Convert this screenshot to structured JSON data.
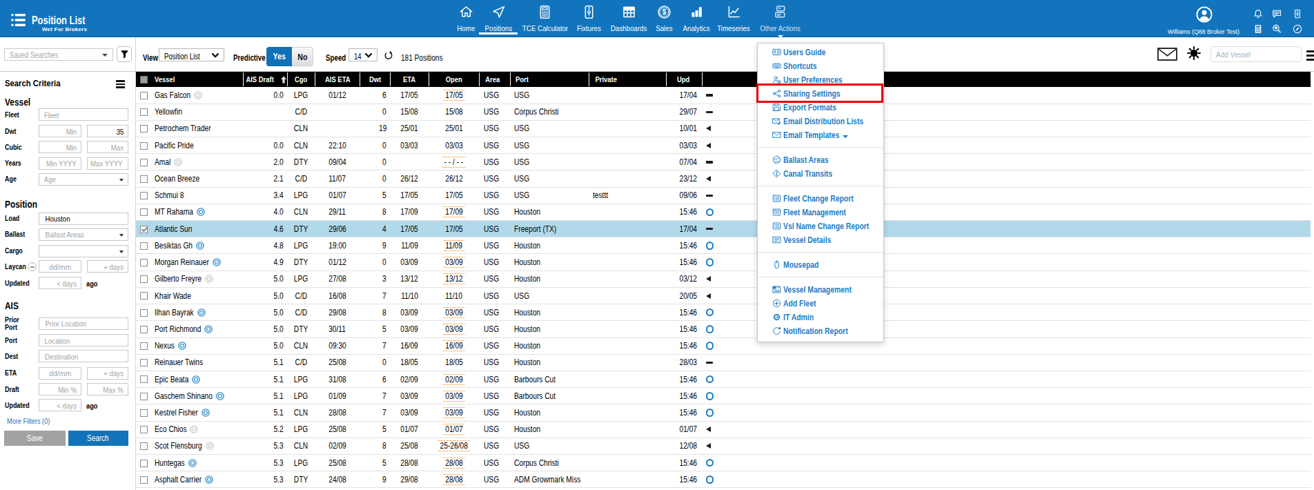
{
  "topbar": {
    "logo": {
      "title": "Position List",
      "subtitle": "Wet For Brokers"
    },
    "nav": [
      {
        "icon": "home-icon",
        "label": "Home"
      },
      {
        "icon": "positions-icon",
        "label": "Positions",
        "active": true
      },
      {
        "icon": "tce-calculator-icon",
        "label": "TCE Calculator"
      },
      {
        "icon": "fixtures-icon",
        "label": "Fixtures"
      },
      {
        "icon": "dashboards-icon",
        "label": "Dashboards"
      },
      {
        "icon": "sales-icon",
        "label": "Sales"
      },
      {
        "icon": "analytics-icon",
        "label": "Analytics"
      },
      {
        "icon": "timeseries-icon",
        "label": "Timeseries"
      },
      {
        "icon": "other-actions-icon",
        "label": "Other Actions",
        "open": true
      }
    ],
    "user": {
      "name": "Williams (Q88 Broker Test)"
    },
    "quick_icons": [
      "bell-icon",
      "chat-icon",
      "zip-icon",
      "calculator-icon",
      "vessel-search-icon",
      "compass-icon"
    ]
  },
  "toolbar": {
    "saved_searches_placeholder": "Saved Searches",
    "view_label": "View",
    "view_value": "Position List",
    "predictive_label": "Predictive",
    "predictive_options": [
      "Yes",
      "No"
    ],
    "predictive_selected": "Yes",
    "speed_label": "Speed",
    "speed_value": "14",
    "position_count": "181 Positions",
    "add_vessel_placeholder": "Add Vessel"
  },
  "sidebar": {
    "title": "Search Criteria",
    "sections": [
      {
        "title": "Vessel",
        "rows": [
          {
            "label": "Fleet",
            "widgets": [
              {
                "type": "input",
                "placeholder": "Fleet",
                "span": "full",
                "align": "l"
              }
            ]
          },
          {
            "label": "Dwt",
            "widgets": [
              {
                "type": "input",
                "placeholder": "Min",
                "span": "p1",
                "align": "r"
              },
              {
                "type": "input",
                "value": "35",
                "span": "p2",
                "align": "r"
              }
            ]
          },
          {
            "label": "Cubic",
            "widgets": [
              {
                "type": "input",
                "placeholder": "Min",
                "span": "p1",
                "align": "r"
              },
              {
                "type": "input",
                "placeholder": "Max",
                "span": "p2",
                "align": "r"
              }
            ]
          },
          {
            "label": "Years",
            "widgets": [
              {
                "type": "input",
                "placeholder": "Min YYYY",
                "span": "p1",
                "align": "r"
              },
              {
                "type": "input",
                "placeholder": "Max YYYY",
                "span": "p2",
                "align": "r"
              }
            ]
          },
          {
            "label": "Age",
            "widgets": [
              {
                "type": "select",
                "placeholder": "Age",
                "span": "full",
                "align": "l"
              }
            ]
          }
        ]
      },
      {
        "title": "Position",
        "rows": [
          {
            "label": "Load",
            "widgets": [
              {
                "type": "input",
                "value": "Houston",
                "span": "full",
                "align": "l"
              }
            ]
          },
          {
            "label": "Ballast",
            "widgets": [
              {
                "type": "select",
                "placeholder": "Ballast Areas",
                "span": "full",
                "align": "l"
              }
            ]
          },
          {
            "label": "Cargo",
            "widgets": [
              {
                "type": "select",
                "placeholder": "",
                "span": "full",
                "align": "l"
              }
            ]
          },
          {
            "label": "Laycan",
            "minus_button": true,
            "widgets": [
              {
                "type": "input",
                "placeholder": "dd/mm",
                "span": "p1",
                "align": "c"
              },
              {
                "type": "input",
                "placeholder": "+ days",
                "span": "p2",
                "align": "r"
              }
            ]
          },
          {
            "label": "Updated",
            "widgets": [
              {
                "type": "input",
                "placeholder": "< days",
                "span": "p1",
                "align": "r"
              },
              {
                "type": "text",
                "value": "ago"
              }
            ]
          }
        ]
      },
      {
        "title": "AIS",
        "rows": [
          {
            "label": "Prior\nPort",
            "widgets": [
              {
                "type": "input",
                "placeholder": "Prior Location",
                "span": "full",
                "align": "l"
              }
            ]
          },
          {
            "label": "Port",
            "widgets": [
              {
                "type": "input",
                "placeholder": "Location",
                "span": "full",
                "align": "l"
              }
            ]
          },
          {
            "label": "Dest",
            "widgets": [
              {
                "type": "input",
                "placeholder": "Destination",
                "span": "full",
                "align": "l"
              }
            ]
          },
          {
            "label": "ETA",
            "widgets": [
              {
                "type": "input",
                "placeholder": "dd/mm",
                "span": "p1",
                "align": "c"
              },
              {
                "type": "input",
                "placeholder": "+ days",
                "span": "p2",
                "align": "r"
              }
            ]
          },
          {
            "label": "Draft",
            "widgets": [
              {
                "type": "input",
                "placeholder": "Min %",
                "span": "p1",
                "align": "r"
              },
              {
                "type": "input",
                "placeholder": "Max %",
                "span": "p2",
                "align": "r"
              }
            ]
          },
          {
            "label": "Updated",
            "widgets": [
              {
                "type": "input",
                "placeholder": "< days",
                "span": "p1",
                "align": "r"
              },
              {
                "type": "text",
                "value": "ago"
              }
            ]
          }
        ]
      }
    ],
    "more_filters_label": "More Filters (0)",
    "save_label": "Save",
    "search_label": "Search"
  },
  "table": {
    "columns": [
      "Vessel",
      "AIS Draft",
      "Cgo",
      "AIS ETA",
      "Dwt",
      "ETA",
      "Open",
      "Area",
      "Port",
      "Private",
      "Upd"
    ],
    "sort": {
      "column": "AIS Draft",
      "direction": "asc"
    },
    "rows": [
      {
        "vessel": "Gas Falcon",
        "vicon": "gray",
        "draft": "0.0",
        "cgo": "LPG",
        "aiseta": "01/12",
        "dwt": "6",
        "eta": "17/05",
        "open": "17/05",
        "est": true,
        "area": "USG",
        "port": "USG",
        "private": "",
        "upd": "17/04",
        "uicon": "dash"
      },
      {
        "vessel": "Yellowfin",
        "vicon": null,
        "draft": "",
        "cgo": "C/D",
        "aiseta": "",
        "dwt": "0",
        "eta": "15/08",
        "open": "15/08",
        "est": false,
        "area": "USG",
        "port": "Corpus Christi",
        "private": "",
        "upd": "29/07",
        "uicon": "dash"
      },
      {
        "vessel": "Petrochem Trader",
        "vicon": null,
        "draft": "",
        "cgo": "CLN",
        "aiseta": "",
        "dwt": "19",
        "eta": "25/01",
        "open": "25/01",
        "est": false,
        "area": "USG",
        "port": "USG",
        "private": "",
        "upd": "10/01",
        "uicon": "tri"
      },
      {
        "vessel": "Pacific Pride",
        "vicon": null,
        "draft": "0.0",
        "cgo": "CLN",
        "aiseta": "22:10",
        "dwt": "0",
        "eta": "03/03",
        "open": "03/03",
        "est": false,
        "area": "USG",
        "port": "USG",
        "private": "",
        "upd": "03/03",
        "uicon": "tri"
      },
      {
        "vessel": "Amal",
        "vicon": "gray",
        "draft": "2.0",
        "cgo": "DTY",
        "aiseta": "09/04",
        "dwt": "0",
        "eta": "",
        "open": "- - / - -",
        "est": true,
        "area": "USG",
        "port": "USG",
        "private": "",
        "upd": "07/04",
        "uicon": "dash"
      },
      {
        "vessel": "Ocean Breeze",
        "vicon": null,
        "draft": "2.1",
        "cgo": "C/D",
        "aiseta": "11/07",
        "dwt": "0",
        "eta": "26/12",
        "open": "26/12",
        "est": false,
        "area": "USG",
        "port": "USG",
        "private": "",
        "upd": "23/12",
        "uicon": "tri"
      },
      {
        "vessel": "Schmui 8",
        "vicon": null,
        "draft": "3.4",
        "cgo": "LPG",
        "aiseta": "01/07",
        "dwt": "5",
        "eta": "17/05",
        "open": "17/05",
        "est": false,
        "area": "USG",
        "port": "USG",
        "private": "testtt",
        "upd": "09/06",
        "uicon": "dash"
      },
      {
        "vessel": "MT Rahama",
        "vicon": "blue",
        "draft": "4.0",
        "cgo": "CLN",
        "aiseta": "29/11",
        "dwt": "8",
        "eta": "17/09",
        "open": "17/09",
        "est": true,
        "area": "USG",
        "port": "Houston",
        "private": "",
        "upd": "15:46",
        "uicon": "circle"
      },
      {
        "vessel": "Atlantic Sun",
        "vicon": null,
        "draft": "4.6",
        "cgo": "DTY",
        "aiseta": "29/06",
        "dwt": "4",
        "eta": "17/05",
        "open": "17/05",
        "est": false,
        "area": "USG",
        "port": "Freeport (TX)",
        "private": "",
        "upd": "17/04",
        "uicon": "dash",
        "selected": true,
        "checked": true
      },
      {
        "vessel": "Besiktas Gh",
        "vicon": "blue",
        "draft": "4.8",
        "cgo": "LPG",
        "aiseta": "19:00",
        "dwt": "9",
        "eta": "11/09",
        "open": "11/09",
        "est": true,
        "area": "USG",
        "port": "Houston",
        "private": "",
        "upd": "15:46",
        "uicon": "circle"
      },
      {
        "vessel": "Morgan Reinauer",
        "vicon": "blue",
        "draft": "4.9",
        "cgo": "DTY",
        "aiseta": "01/12",
        "dwt": "0",
        "eta": "03/09",
        "open": "03/09",
        "est": true,
        "area": "USG",
        "port": "Houston",
        "private": "",
        "upd": "15:46",
        "uicon": "circle"
      },
      {
        "vessel": "Gilberto Freyre",
        "vicon": "gray",
        "draft": "5.0",
        "cgo": "LPG",
        "aiseta": "27/08",
        "dwt": "3",
        "eta": "13/12",
        "open": "13/12",
        "est": true,
        "area": "USG",
        "port": "Houston",
        "private": "",
        "upd": "03/12",
        "uicon": "tri"
      },
      {
        "vessel": "Khair Wade",
        "vicon": null,
        "draft": "5.0",
        "cgo": "C/D",
        "aiseta": "16/08",
        "dwt": "7",
        "eta": "11/10",
        "open": "11/10",
        "est": false,
        "area": "USG",
        "port": "USG",
        "private": "",
        "upd": "20/05",
        "uicon": "tri"
      },
      {
        "vessel": "Ilhan Bayrak",
        "vicon": "blue",
        "draft": "5.0",
        "cgo": "C/D",
        "aiseta": "29/08",
        "dwt": "8",
        "eta": "03/09",
        "open": "03/09",
        "est": true,
        "area": "USG",
        "port": "Houston",
        "private": "",
        "upd": "15:46",
        "uicon": "circle"
      },
      {
        "vessel": "Port Richmond",
        "vicon": "blue",
        "draft": "5.0",
        "cgo": "DTY",
        "aiseta": "30/11",
        "dwt": "5",
        "eta": "03/09",
        "open": "03/09",
        "est": true,
        "area": "USG",
        "port": "Houston",
        "private": "",
        "upd": "15:46",
        "uicon": "circle"
      },
      {
        "vessel": "Nexus",
        "vicon": "blue",
        "draft": "5.0",
        "cgo": "CLN",
        "aiseta": "09:30",
        "dwt": "7",
        "eta": "16/09",
        "open": "16/09",
        "est": true,
        "area": "USG",
        "port": "Houston",
        "private": "",
        "upd": "15:46",
        "uicon": "circle"
      },
      {
        "vessel": "Reinauer Twins",
        "vicon": null,
        "draft": "5.1",
        "cgo": "C/D",
        "aiseta": "25/08",
        "dwt": "0",
        "eta": "18/05",
        "open": "18/05",
        "est": false,
        "area": "USG",
        "port": "Houston",
        "private": "",
        "upd": "28/03",
        "uicon": "dash"
      },
      {
        "vessel": "Epic Beata",
        "vicon": "blue",
        "draft": "5.1",
        "cgo": "LPG",
        "aiseta": "31/08",
        "dwt": "6",
        "eta": "02/09",
        "open": "02/09",
        "est": true,
        "area": "USG",
        "port": "Barbours Cut",
        "private": "",
        "upd": "15:46",
        "uicon": "circle"
      },
      {
        "vessel": "Gaschem Shinano",
        "vicon": "blue",
        "draft": "5.1",
        "cgo": "LPG",
        "aiseta": "01/09",
        "dwt": "7",
        "eta": "03/09",
        "open": "03/09",
        "est": true,
        "area": "USG",
        "port": "Barbours Cut",
        "private": "",
        "upd": "15:46",
        "uicon": "circle"
      },
      {
        "vessel": "Kestrel Fisher",
        "vicon": "blue",
        "draft": "5.1",
        "cgo": "CLN",
        "aiseta": "28/08",
        "dwt": "7",
        "eta": "03/09",
        "open": "03/09",
        "est": true,
        "area": "USG",
        "port": "Houston",
        "private": "",
        "upd": "15:46",
        "uicon": "circle"
      },
      {
        "vessel": "Eco Chios",
        "vicon": "gray",
        "draft": "5.2",
        "cgo": "LPG",
        "aiseta": "25/08",
        "dwt": "5",
        "eta": "01/07",
        "open": "01/07",
        "est": true,
        "area": "USG",
        "port": "Houston",
        "private": "",
        "upd": "01/07",
        "uicon": "tri"
      },
      {
        "vessel": "Scot Flensburg",
        "vicon": "gray",
        "draft": "5.3",
        "cgo": "CLN",
        "aiseta": "02/09",
        "dwt": "8",
        "eta": "25/08",
        "open": "25-26/08",
        "est": true,
        "area": "USG",
        "port": "USG",
        "private": "",
        "upd": "12/08",
        "uicon": "tri"
      },
      {
        "vessel": "Huntegas",
        "vicon": "blue",
        "draft": "5.3",
        "cgo": "LPG",
        "aiseta": "25/08",
        "dwt": "5",
        "eta": "28/08",
        "open": "28/08",
        "est": true,
        "area": "USG",
        "port": "Corpus Christi",
        "private": "",
        "upd": "15:46",
        "uicon": "circle"
      },
      {
        "vessel": "Asphalt Carrier",
        "vicon": "blue",
        "draft": "5.3",
        "cgo": "DTY",
        "aiseta": "24/08",
        "dwt": "9",
        "eta": "29/08",
        "open": "28/08",
        "est": true,
        "area": "USG",
        "port": "ADM Growmark Miss",
        "private": "",
        "upd": "15:46",
        "uicon": "circle"
      }
    ]
  },
  "actions_menu": {
    "groups": [
      [
        {
          "icon": "users-guide-icon",
          "label": "Users Guide"
        },
        {
          "icon": "shortcuts-icon",
          "label": "Shortcuts"
        },
        {
          "icon": "user-preferences-icon",
          "label": "User Preferences"
        },
        {
          "icon": "sharing-settings-icon",
          "label": "Sharing Settings",
          "highlighted": true
        },
        {
          "icon": "export-formats-icon",
          "label": "Export Formats"
        },
        {
          "icon": "email-distribution-lists-icon",
          "label": "Email Distribution Lists"
        },
        {
          "icon": "email-templates-icon",
          "label": "Email Templates",
          "caret": true
        }
      ],
      [
        {
          "icon": "ballast-areas-icon",
          "label": "Ballast Areas"
        },
        {
          "icon": "canal-transits-icon",
          "label": "Canal Transits"
        }
      ],
      [
        {
          "icon": "fleet-change-report-icon",
          "label": "Fleet Change Report"
        },
        {
          "icon": "fleet-management-icon",
          "label": "Fleet Management"
        },
        {
          "icon": "vsl-name-change-report-icon",
          "label": "Vsl Name Change Report"
        },
        {
          "icon": "vessel-details-icon",
          "label": "Vessel Details"
        }
      ],
      [
        {
          "icon": "mousepad-icon",
          "label": "Mousepad"
        }
      ],
      [
        {
          "icon": "vessel-management-icon",
          "label": "Vessel Management"
        },
        {
          "icon": "add-fleet-icon",
          "label": "Add Fleet"
        },
        {
          "icon": "it-admin-icon",
          "label": "IT Admin"
        },
        {
          "icon": "notification-report-icon",
          "label": "Notification Report"
        }
      ]
    ]
  },
  "annotation": {
    "type": "highlight-box",
    "target": "Sharing Settings",
    "color": "#e50000"
  }
}
